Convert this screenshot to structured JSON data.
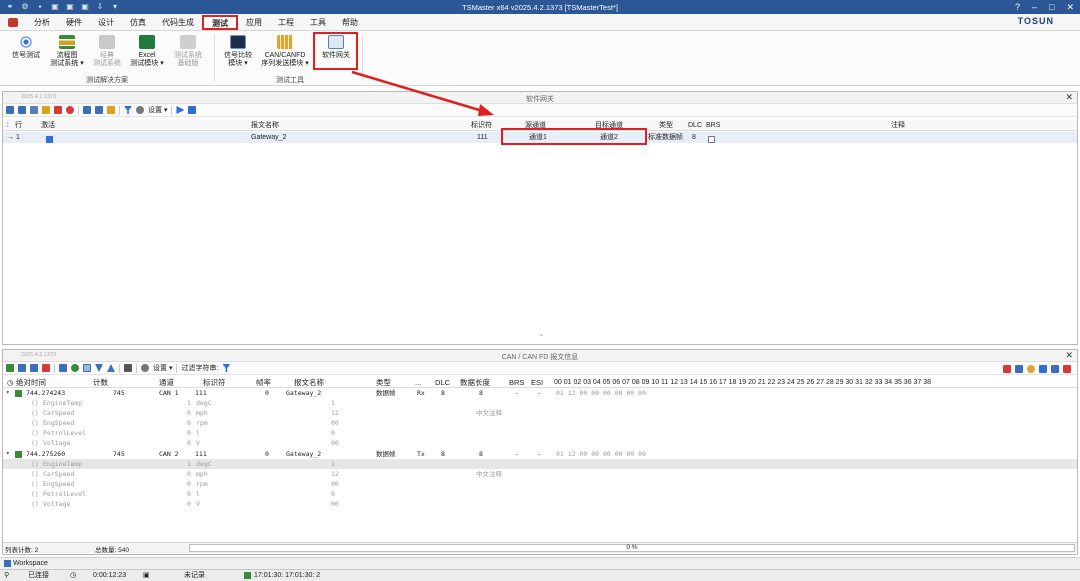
{
  "window": {
    "title": "TSMaster x64 v2025.4.2.1373 [TSMasterTest*]",
    "help": "?",
    "min": "–",
    "max": "□",
    "close": "✕"
  },
  "menu": [
    "分析",
    "硬件",
    "设计",
    "仿真",
    "代码生成",
    "测试",
    "应用",
    "工程",
    "工具",
    "帮助"
  ],
  "brand": "TOSUN",
  "ribbon": {
    "buttons": [
      {
        "label1": "信号测试",
        "label2": ""
      },
      {
        "label1": "流程图",
        "label2": "测试系统 ▾"
      },
      {
        "label1": "经典",
        "label2": "测试系统"
      },
      {
        "label1": "Excel",
        "label2": "测试模块 ▾"
      },
      {
        "label1": "测试系统",
        "label2": "基础版"
      },
      {
        "label1": "信号比较",
        "label2": "模块 ▾"
      },
      {
        "label1": "CAN/CANFD",
        "label2": "序列发送模块 ▾"
      },
      {
        "label1": "软件网关",
        "label2": ""
      }
    ],
    "group1": "测试解决方案",
    "group2": "测试工具"
  },
  "gateway": {
    "version": "2025.4.2.1373",
    "title": "软件网关",
    "toolbar_settings": "设置 ▾",
    "headers": {
      "row": "行",
      "active": "激活",
      "msg": "报文名称",
      "id": "标识符",
      "src": "源通道",
      "dst": "目标通道",
      "type": "类型",
      "dlc": "DLC",
      "brs": "BRS",
      "note": "注释"
    },
    "row": {
      "arrow": "→",
      "index": "1",
      "msg": "Gateway_2",
      "id": "111",
      "src": "通道1",
      "dst": "通道2",
      "type": "标准数据帧",
      "dlc": "8"
    }
  },
  "trace": {
    "version": "2025.4.2.1373",
    "title": "CAN / CAN FD 报文信息",
    "toolbar_settings": "设置 ▾",
    "toolbar_filter": "过滤字符串:",
    "headers": {
      "time": "绝对时间",
      "count": "计数",
      "channel": "通道",
      "id": "标识符",
      "rate": "帧率",
      "msg": "报文名称",
      "type": "类型",
      "dots": "...",
      "dlc": "DLC",
      "len": "数据长度",
      "brs": "BRS",
      "esi": "ESI",
      "bytes": "00 01 02 03 04 05 06 07 08 09 10 11 12 13 14 15 16 17 18 19 20 21 22 23 24 25 26 27 28 29 30 31 32 33 34 35 36 37 38"
    },
    "frames": [
      {
        "time": "744.274243",
        "count": "745",
        "channel": "CAN 1",
        "id": "111",
        "rate": "0",
        "msg": "Gateway_2",
        "type": "数据帧",
        "dir": "Rx",
        "dlc": "8",
        "len": "8",
        "brs": "-",
        "esi": "-",
        "data": "01 12 00 00 00 00 00 00",
        "note": "中文注释",
        "signals": [
          {
            "name": "EngineTemp",
            "raw": "1",
            "unit": "degC",
            "val": "1"
          },
          {
            "name": "CarSpeed",
            "raw": "0",
            "unit": "mph",
            "val": "12"
          },
          {
            "name": "EngSpeed",
            "raw": "0",
            "unit": "rpm",
            "val": "00"
          },
          {
            "name": "PetrolLevel",
            "raw": "0",
            "unit": "l",
            "val": "0"
          },
          {
            "name": "Voltage",
            "raw": "0",
            "unit": "V",
            "val": "00"
          }
        ]
      },
      {
        "time": "744.275260",
        "count": "745",
        "channel": "CAN 2",
        "id": "111",
        "rate": "0",
        "msg": "Gateway_2",
        "type": "数据帧",
        "dir": "Tx",
        "dlc": "8",
        "len": "8",
        "brs": "-",
        "esi": "-",
        "data": "01 12 00 00 00 00 00 00",
        "note": "中文注释",
        "signals": [
          {
            "name": "EngineTemp",
            "raw": "1",
            "unit": "degC",
            "val": "1"
          },
          {
            "name": "CarSpeed",
            "raw": "0",
            "unit": "mph",
            "val": "12"
          },
          {
            "name": "EngSpeed",
            "raw": "0",
            "unit": "rpm",
            "val": "00"
          },
          {
            "name": "PetrolLevel",
            "raw": "0",
            "unit": "l",
            "val": "0"
          },
          {
            "name": "Voltage",
            "raw": "0",
            "unit": "V",
            "val": "00"
          }
        ]
      }
    ],
    "list_count": "列表计数: 2",
    "total_count": "总数量: 540",
    "progress": "0 %",
    "progress_value": 0
  },
  "workspace_tab": "Workspace",
  "status": {
    "connection": "已连接",
    "elapsed": "0:00:12:23",
    "recording": "未记录",
    "timestamp": "17:01:30: 17:01:30: 2"
  },
  "colors": {
    "titlebar": "#2b5797",
    "highlight": "#e02020",
    "accent": "#2f6fd6"
  }
}
